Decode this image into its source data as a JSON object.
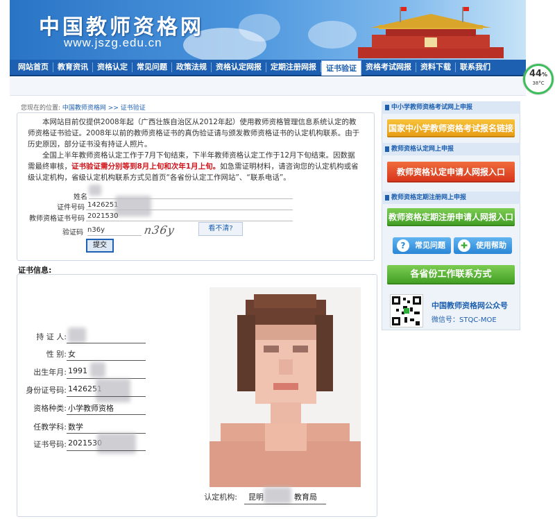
{
  "header": {
    "logo_title": "中国教师资格网",
    "logo_url": "www.jszg.edu.cn"
  },
  "nav": {
    "items": [
      "网站首页",
      "教育资讯",
      "资格认定",
      "常见问题",
      "政策法规",
      "资格认定网报",
      "定期注册网报",
      "证书验证",
      "资格考试网报",
      "资料下载",
      "联系我们"
    ],
    "active_index": 7
  },
  "badge": {
    "percent": "44",
    "percent_sign": "%",
    "temp": "38°C",
    "colors": {
      "ring": "#3cbe5a"
    }
  },
  "breadcrumb": {
    "prefix": "您现在的位置:",
    "path": "中国教师资格网 >> 证书验证"
  },
  "notice": {
    "p1": "本网站目前仅提供2008年起（广西壮族自治区从2012年起）使用教师资格管理信息系统认定的教师资格证书验证。2008年以前的教师资格证书的真伪验证请与颁发教师资格证书的认定机构联系。由于历史原因，部分证书没有持证人照片。",
    "p2a": "全国上半年教师资格认定工作于7月下旬结束，下半年教师资格认定工作于12月下旬结束。因数据需最终审核，",
    "p2red": "证书验证需分别等到8月上旬和次年1月上旬。",
    "p2b": "如急需证明材料，请咨询您的认定机构或省级认定机构，省级认定机构联系方式见首页“各省份认定工作网站”、“联系电话”。"
  },
  "form": {
    "name_label": "姓名",
    "id_label": "证件号码",
    "id_value": "1426251",
    "cert_label": "教师资格证书号码",
    "cert_value": "2021530",
    "captcha_label": "验证码",
    "captcha_value": "n36y",
    "captcha_image_text": "n36y",
    "see_unclear": "看不清?",
    "submit": "提交"
  },
  "certificate": {
    "section_title": "证书信息:",
    "holder_label": "持 证 人:",
    "gender_label": "性    别:",
    "gender_value": "女",
    "birth_label": "出生年月:",
    "birth_value": "1991",
    "idnum_label": "身份证号码:",
    "idnum_value": "1426251",
    "type_label": "资格种类:",
    "type_value": "小学教师资格",
    "subject_label": "任教学科:",
    "subject_value": "数学",
    "certno_label": "证书号码:",
    "certno_value": "2021530",
    "org_label": "认定机构:",
    "org_value_a": "昆明",
    "org_value_b": "教育局"
  },
  "sidebar": {
    "h1": "中小学教师资格考试网上申报",
    "btn1": "国家中小学教师资格考试报名链接",
    "h2": "教师资格认定网上申报",
    "btn2": "教师资格认定申请人网报入口",
    "h3": "教师资格定期注册网上申报",
    "btn3": "教师资格定期注册申请人网报入口",
    "faq": "常见问题",
    "help": "使用帮助",
    "contact": "各省份工作联系方式",
    "qr_title": "中国教师资格网公众号",
    "qr_sub": "微信号：STQC-MOE"
  }
}
